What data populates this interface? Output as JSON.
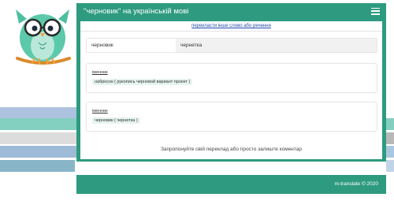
{
  "header": {
    "title": "\"черновик\" на українській мові"
  },
  "link": {
    "other": "перекласти інше слово або речення"
  },
  "word": {
    "source": "черновик",
    "translation": "чернетка"
  },
  "entries": [
    {
      "pos": "іменник",
      "translation": "набросок ( рукопись черновой вариант проект )"
    },
    {
      "pos": "іменник",
      "translation": "черновик ( чернетка )"
    }
  ],
  "suggest": "Запропонуйте свій переклад або просто залиште коментар",
  "footer": {
    "copyright": "m-translate © 2020"
  },
  "colors": {
    "brand": "#2e9b80",
    "link": "#1f4ba8"
  },
  "icons": {
    "menu": "hamburger-menu-icon",
    "logo": "owl-logo"
  }
}
